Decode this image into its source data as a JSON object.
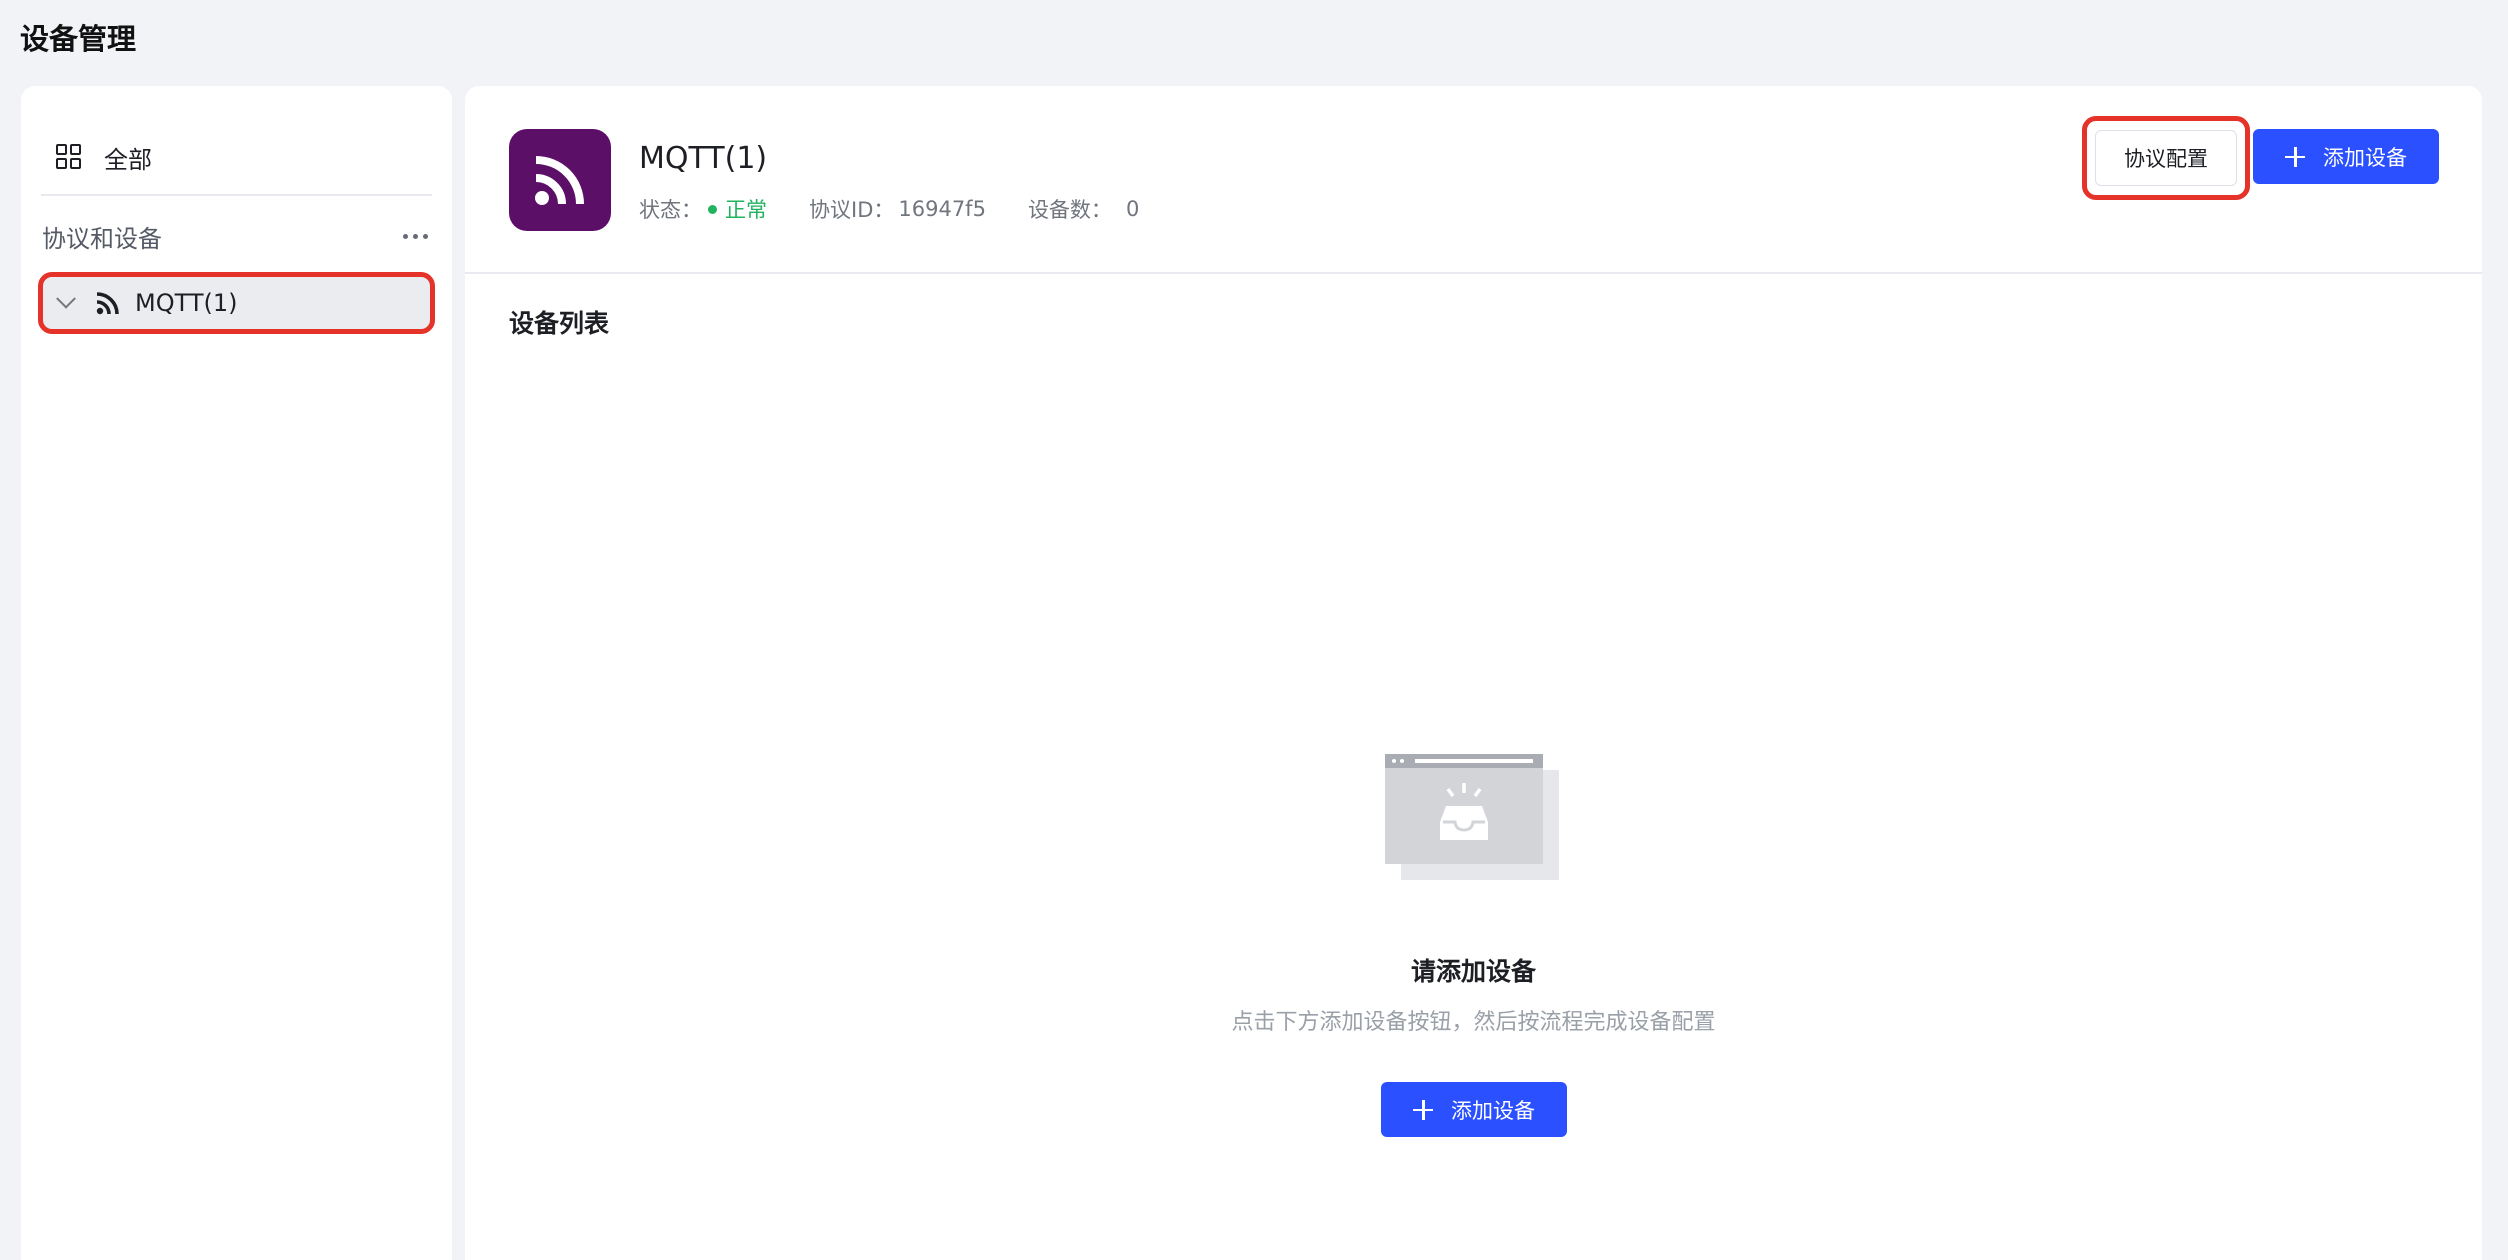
{
  "page": {
    "title": "设备管理"
  },
  "sidebar": {
    "all_label": "全部",
    "section_title": "协议和设备",
    "tree_items": [
      {
        "label": "MQTT(1)",
        "icon": "rss-icon"
      }
    ]
  },
  "protocol": {
    "name": "MQTT(1)",
    "status_label": "状态：",
    "status_value": "正常",
    "id_label": "协议ID：",
    "id_value": "16947f5",
    "count_label": "设备数：",
    "count_value": "0",
    "logo_color": "#5c0f66"
  },
  "actions": {
    "config_label": "协议配置",
    "add_device_label": "添加设备"
  },
  "device_list": {
    "title": "设备列表",
    "empty_title": "请添加设备",
    "empty_subtitle": "点击下方添加设备按钮，然后按流程完成设备配置",
    "add_device_label": "添加设备"
  },
  "colors": {
    "primary": "#2b50ff",
    "success": "#22b35e",
    "highlight": "#e5332a"
  }
}
